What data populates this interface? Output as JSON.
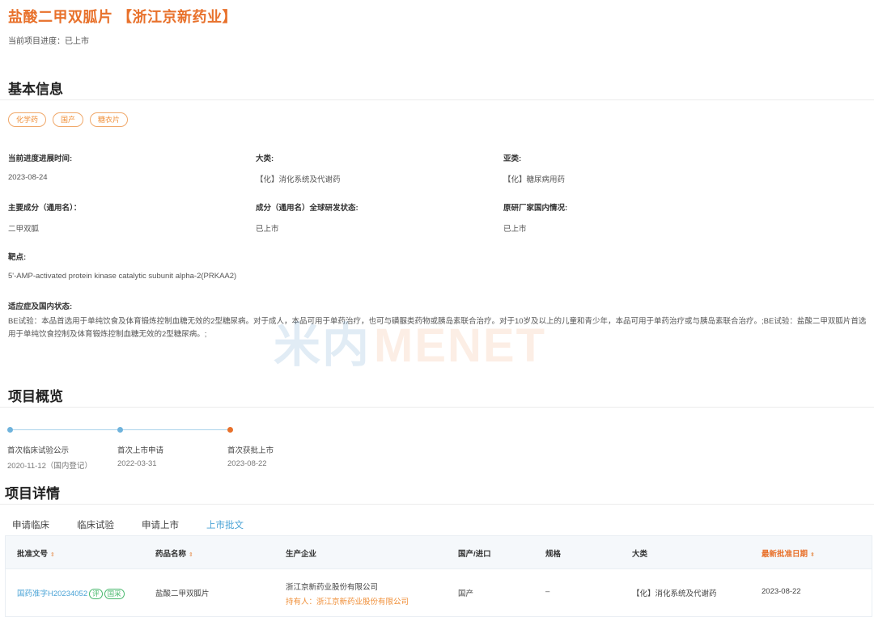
{
  "header": {
    "title": "盐酸二甲双胍片 【浙江京新药业】",
    "progress_label": "当前项目进度：",
    "progress_value": "已上市"
  },
  "basic": {
    "section_title": "基本信息",
    "tags": [
      "化学药",
      "国产",
      "糖衣片"
    ],
    "fields": [
      {
        "label": "当前进度进展时间:",
        "value": "2023-08-24"
      },
      {
        "label": "大类:",
        "value": "【化】消化系统及代谢药"
      },
      {
        "label": "亚类:",
        "value": "【化】糖尿病用药"
      },
      {
        "label": "主要成分（通用名）：",
        "value": "二甲双胍"
      },
      {
        "label": "成分（通用名）全球研发状态:",
        "value": "已上市"
      },
      {
        "label": "原研厂家国内情况:",
        "value": "已上市"
      },
      {
        "label": "靶点:",
        "value": "5'-AMP-activated protein kinase catalytic subunit alpha-2(PRKAA2)"
      }
    ],
    "indication_label": "适应症及国内状态:",
    "indication_text": "BE试验：本品首选用于单纯饮食及体育锻炼控制血糖无效的2型糖尿病。对于成人，本品可用于单药治疗，也可与磺脲类药物或胰岛素联合治疗。对于10岁及以上的儿童和青少年，本品可用于单药治疗或与胰岛素联合治疗。;BE试验：盐酸二甲双胍片首选用于单纯饮食控制及体育锻炼控制血糖无效的2型糖尿病。;"
  },
  "watermark": {
    "cn": "米内",
    "en": "MENET"
  },
  "overview": {
    "section_title": "项目概览",
    "milestones": [
      {
        "label": "首次临床试验公示",
        "date": "2020-11-12（国内登记）",
        "color": "#6fb3dc"
      },
      {
        "label": "首次上市申请",
        "date": "2022-03-31",
        "color": "#6fb3dc"
      },
      {
        "label": "首次获批上市",
        "date": "2023-08-22",
        "color": "#e8712b"
      }
    ]
  },
  "details": {
    "section_title": "项目详情",
    "tabs": [
      "申请临床",
      "临床试验",
      "申请上市",
      "上市批文"
    ],
    "active_tab": 3,
    "columns": [
      "批准文号",
      "药品名称",
      "生产企业",
      "国产/进口",
      "规格",
      "大类",
      "最新批准日期"
    ],
    "row": {
      "approval_no": "国药准字H20234052",
      "badge1": "评",
      "badge2": "国采",
      "drug_name": "盐酸二甲双胍片",
      "manufacturer": "浙江京新药业股份有限公司",
      "holder": "持有人：浙江京新药业股份有限公司",
      "origin": "国产",
      "spec": "–",
      "category": "【化】消化系统及代谢药",
      "date": "2023-08-22"
    }
  }
}
